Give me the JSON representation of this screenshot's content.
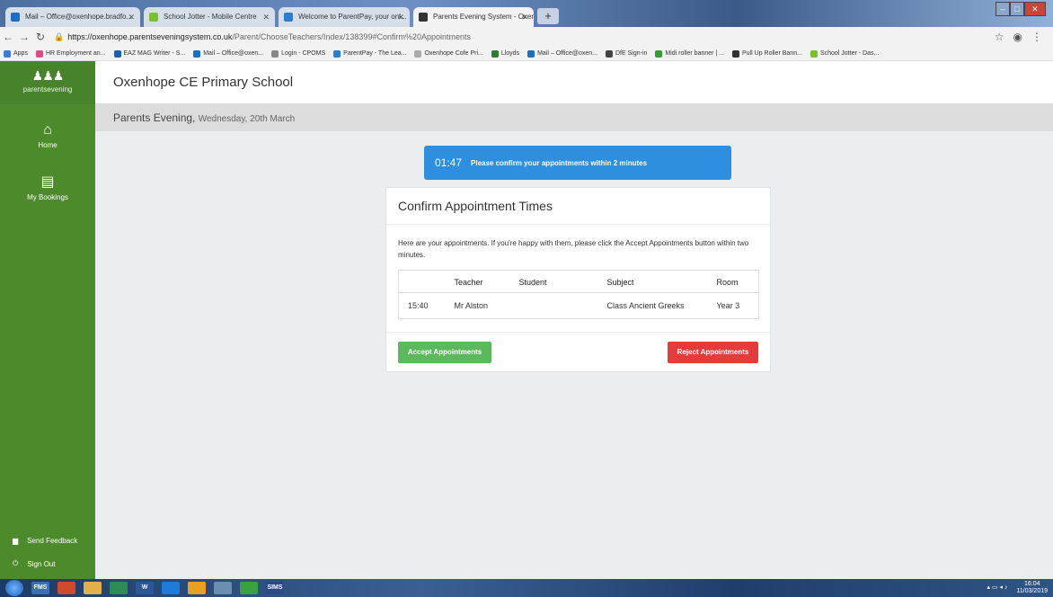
{
  "browser": {
    "tabs": [
      {
        "label": "Mail – Office@oxenhope.bradfo...",
        "color": "#1a6fc4"
      },
      {
        "label": "School Jotter - Mobile Centre",
        "color": "#7bbf2a"
      },
      {
        "label": "Welcome to ParentPay, your onl...",
        "color": "#2a7ed0"
      },
      {
        "label": "Parents Evening System - Oxenh...",
        "color": "#333333"
      }
    ],
    "new_tab": "+",
    "url_host": "https://oxenhope.parentseveningsystem.co.uk",
    "url_path": "/Parent/ChooseTeachers/Index/138399#Confirm%20Appointments",
    "bookmarks": [
      {
        "label": "Apps",
        "color": "#3a7bd5"
      },
      {
        "label": "HR Employment an...",
        "color": "#e04a8a"
      },
      {
        "label": "EAZ MAG Writer - S...",
        "color": "#1a5fb4"
      },
      {
        "label": "Mail – Office@oxen...",
        "color": "#1a6fc4"
      },
      {
        "label": "Login - CPOMS",
        "color": "#888888"
      },
      {
        "label": "ParentPay - The Lea...",
        "color": "#2a7ed0"
      },
      {
        "label": "Oxenhope Cofe Pri...",
        "color": "#aaaaaa"
      },
      {
        "label": "Lloyds",
        "color": "#2e7d32"
      },
      {
        "label": "Mail – Office@oxen...",
        "color": "#1a6fc4"
      },
      {
        "label": "DfE Sign-in",
        "color": "#444444"
      },
      {
        "label": "Midi roller banner | ...",
        "color": "#3a9a3a"
      },
      {
        "label": "Pull Up Roller Bann...",
        "color": "#333333"
      },
      {
        "label": "School Jotter - Das...",
        "color": "#7bbf2a"
      }
    ]
  },
  "sidebar": {
    "logo_text": "parentsevening",
    "home": "Home",
    "my_bookings": "My Bookings",
    "send_feedback": "Send Feedback",
    "sign_out": "Sign Out"
  },
  "header": {
    "school": "Oxenhope CE Primary School",
    "event": "Parents Evening,",
    "date": "Wednesday, 20th March"
  },
  "timer": {
    "time": "01:47",
    "message": "Please confirm your appointments within 2 minutes"
  },
  "confirm": {
    "title": "Confirm Appointment Times",
    "description": "Here are your appointments. If you're happy with them, please click the Accept Appointments button within two minutes.",
    "columns": [
      "",
      "Teacher",
      "Student",
      "Subject",
      "Room"
    ],
    "rows": [
      {
        "time": "15:40",
        "teacher": "Mr Alston",
        "student": "",
        "subject": "Class Ancient Greeks",
        "room": "Year 3"
      }
    ],
    "accept_label": "Accept Appointments",
    "reject_label": "Reject Appointments"
  },
  "taskbar": {
    "items": [
      "FMS",
      "",
      "",
      "",
      "W",
      "",
      "",
      "",
      "",
      "SIMS"
    ],
    "time": "16:04",
    "date": "11/03/2019"
  },
  "colors": {
    "sidebar": "#4c8a2b",
    "timer": "#2e8ee0",
    "accept": "#5cb85c",
    "reject": "#e63b3b"
  }
}
